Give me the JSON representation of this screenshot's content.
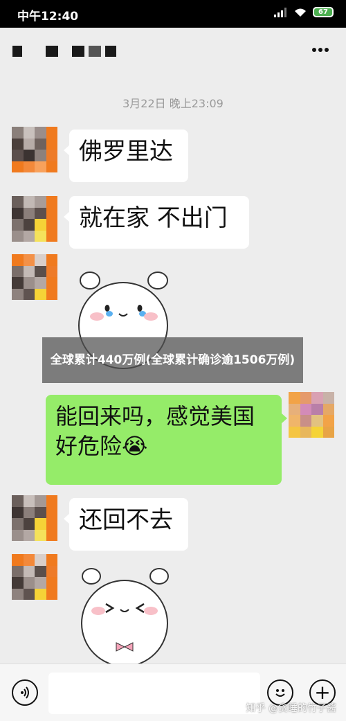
{
  "status_bar": {
    "time": "中午12:40",
    "battery": "67"
  },
  "chat": {
    "timestamp": "3月22日 晚上23:09"
  },
  "messages": [
    {
      "side": "left",
      "text": "佛罗里达"
    },
    {
      "side": "left",
      "text": "就在家 不出门"
    },
    {
      "side": "right",
      "text": "能回来吗，感觉美国好危险😭"
    },
    {
      "side": "left",
      "text": "还回不去"
    }
  ],
  "overlay": {
    "caption": "全球累计440万例(全球累计确诊逾1506万例)"
  },
  "watermark": {
    "text": "知乎 @贪睡的竹子酱"
  },
  "colors": {
    "bubble_right": "#95ec69",
    "background": "#ededed"
  },
  "icons": {
    "more": "more-icon",
    "voice": "voice-icon",
    "emoji": "emoji-icon",
    "plus": "plus-icon"
  }
}
